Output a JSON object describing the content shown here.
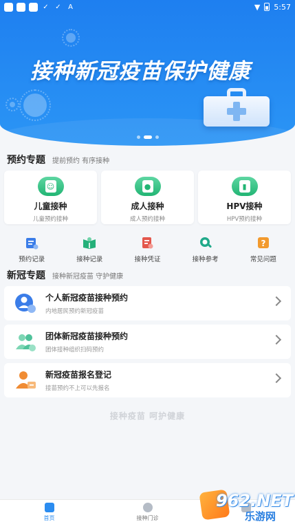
{
  "status": {
    "time": "5:57"
  },
  "banner": {
    "title": "接种新冠疫苗保护健康"
  },
  "appointment": {
    "title": "预约专题",
    "subtitle": "提前预约 有序接种",
    "cards": [
      {
        "title": "儿童接种",
        "sub": "儿童预约接种",
        "icon": "child-icon"
      },
      {
        "title": "成人接种",
        "sub": "成人预约接种",
        "icon": "adult-icon"
      },
      {
        "title": "HPV接种",
        "sub": "HPV预约接种",
        "icon": "hpv-icon"
      }
    ]
  },
  "quick": [
    {
      "label": "预约记录",
      "icon": "appointment-record-icon",
      "color": "#3b7de8"
    },
    {
      "label": "接种记录",
      "icon": "vaccination-record-icon",
      "color": "#25b07a"
    },
    {
      "label": "接种凭证",
      "icon": "certificate-icon",
      "color": "#e4574c"
    },
    {
      "label": "接种参考",
      "icon": "reference-icon",
      "color": "#20a98a"
    },
    {
      "label": "常见问题",
      "icon": "faq-icon",
      "color": "#f29a2e"
    }
  ],
  "covid": {
    "title": "新冠专题",
    "subtitle": "接种新冠疫苗 守护健康",
    "rows": [
      {
        "title": "个人新冠疫苗接种预约",
        "sub": "内地居民预约新冠疫苗",
        "icon": "personal-icon",
        "color": "#3b7de8"
      },
      {
        "title": "团体新冠疫苗接种预约",
        "sub": "团体接种组织扫码预约",
        "icon": "group-icon",
        "color": "#4fc29a"
      },
      {
        "title": "新冠疫苗报名登记",
        "sub": "接苗预约不上可以先报名",
        "icon": "register-icon",
        "color": "#f08c34"
      }
    ]
  },
  "slogan": "接种疫苗 呵护健康",
  "nav": [
    {
      "label": "首页",
      "icon": "home-icon"
    },
    {
      "label": "接种门诊",
      "icon": "clinic-icon"
    }
  ],
  "watermark": {
    "number": "962",
    "net": ".NET",
    "cn": "乐游网"
  }
}
